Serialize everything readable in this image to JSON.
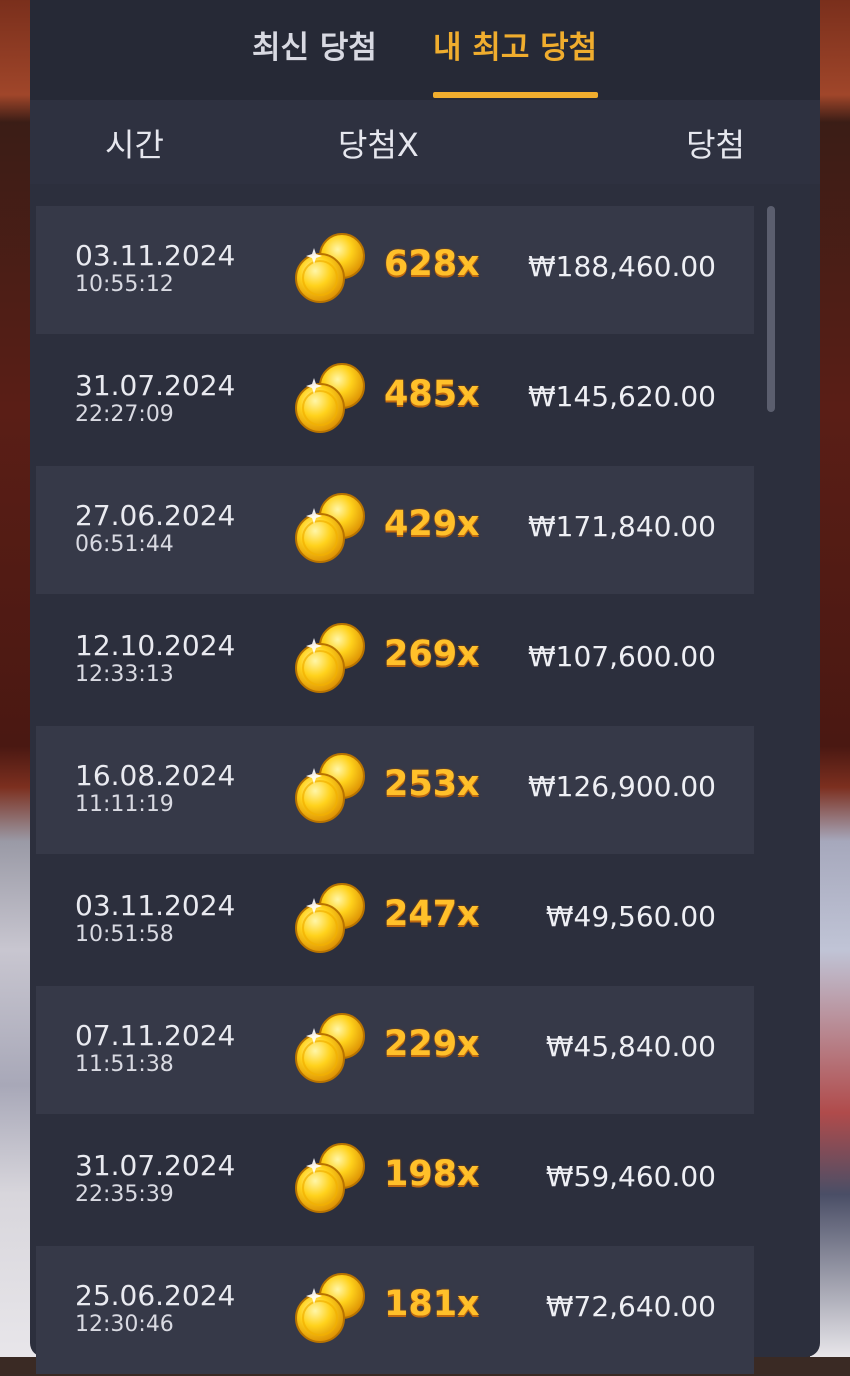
{
  "tabs": {
    "recent": "최신 당첨",
    "best": "내 최고 당첨",
    "active": "best"
  },
  "header": {
    "time": "시간",
    "multiplier": "당첨X",
    "win": "당첨"
  },
  "colors": {
    "accent": "#f0ad2e",
    "multiplier": "#ffc02a",
    "panel": "#2c2f3d"
  },
  "icons": {
    "coin": "gold-coins-icon"
  },
  "rows": [
    {
      "date": "03.11.2024",
      "time": "10:55:12",
      "multiplier": "628x",
      "amount": "₩188,460.00"
    },
    {
      "date": "31.07.2024",
      "time": "22:27:09",
      "multiplier": "485x",
      "amount": "₩145,620.00"
    },
    {
      "date": "27.06.2024",
      "time": "06:51:44",
      "multiplier": "429x",
      "amount": "₩171,840.00"
    },
    {
      "date": "12.10.2024",
      "time": "12:33:13",
      "multiplier": "269x",
      "amount": "₩107,600.00"
    },
    {
      "date": "16.08.2024",
      "time": "11:11:19",
      "multiplier": "253x",
      "amount": "₩126,900.00"
    },
    {
      "date": "03.11.2024",
      "time": "10:51:58",
      "multiplier": "247x",
      "amount": "₩49,560.00"
    },
    {
      "date": "07.11.2024",
      "time": "11:51:38",
      "multiplier": "229x",
      "amount": "₩45,840.00"
    },
    {
      "date": "31.07.2024",
      "time": "22:35:39",
      "multiplier": "198x",
      "amount": "₩59,460.00"
    },
    {
      "date": "25.06.2024",
      "time": "12:30:46",
      "multiplier": "181x",
      "amount": "₩72,640.00"
    }
  ]
}
